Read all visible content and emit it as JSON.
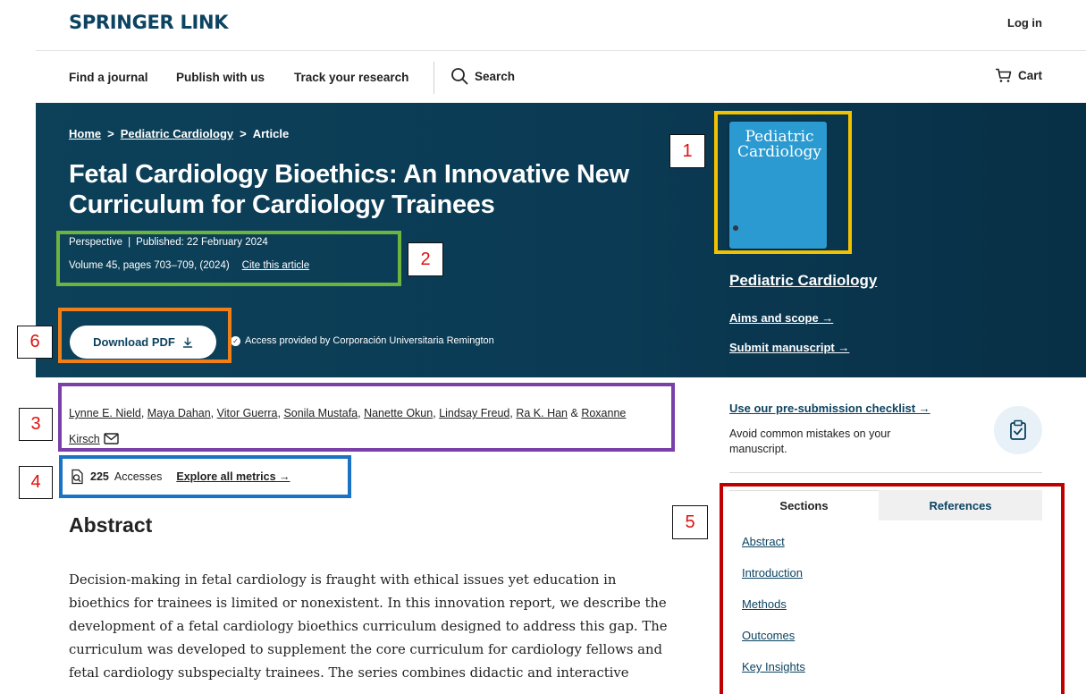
{
  "header": {
    "logo": "SPRINGER LINK",
    "login": "Log in"
  },
  "nav": {
    "find_journal": "Find a journal",
    "publish": "Publish with us",
    "track": "Track your research",
    "search": "Search",
    "cart": "Cart"
  },
  "breadcrumb": {
    "home": "Home",
    "journal": "Pediatric Cardiology",
    "article": "Article",
    "separator": ">"
  },
  "article": {
    "title": "Fetal Cardiology Bioethics: An Innovative New Curriculum for Cardiology Trainees",
    "type": "Perspective",
    "published": "Published: 22 February 2024",
    "volume": "Volume 45, pages 703–709, (2024)",
    "cite": "Cite this article",
    "download_pdf": "Download PDF",
    "access": "Access provided by Corporación Universitaria Remington"
  },
  "journal": {
    "cover_title": "Pediatric Cardiology",
    "name": "Pediatric Cardiology",
    "aims": "Aims and scope →",
    "submit": "Submit manuscript →"
  },
  "authors": {
    "list": [
      "Lynne E. Nield",
      "Maya Dahan",
      "Vitor Guerra",
      "Sonila Mustafa",
      "Nanette Okun",
      "Lindsay Freud",
      "Ra K. Han"
    ],
    "last": "Roxanne Kirsch",
    "amp": "&"
  },
  "metrics": {
    "accesses_count": "225",
    "accesses_label": "Accesses",
    "explore": "Explore all metrics →"
  },
  "abstract": {
    "heading": "Abstract",
    "text": "Decision-making in fetal cardiology is fraught with ethical issues yet education in bioethics for trainees is limited or nonexistent. In this innovation report, we describe the development of a fetal cardiology bioethics curriculum designed to address this gap. The curriculum was developed to supplement the core curriculum for cardiology fellows and fetal cardiology subspecialty trainees. The series combines didactic and interactive"
  },
  "sidebar": {
    "checklist_link": "Use our pre-submission checklist →",
    "checklist_desc": "Avoid common mistakes on your manuscript.",
    "tabs": {
      "sections": "Sections",
      "references": "References"
    },
    "sections": [
      "Abstract",
      "Introduction",
      "Methods",
      "Outcomes",
      "Key Insights"
    ]
  },
  "annotations": {
    "labels": [
      "1",
      "2",
      "3",
      "4",
      "5",
      "6"
    ],
    "colors": {
      "1": "#f2c200",
      "2": "#6db33f",
      "3": "#7a3fa8",
      "4": "#1a73c4",
      "5": "#c00000",
      "6": "#f07f1a"
    }
  },
  "colors": {
    "brand": "#0c4361",
    "hero_bg": "#0b3a54",
    "link": "#0c4361"
  },
  "icons": [
    "search-icon",
    "cart-icon",
    "download-icon",
    "check-icon",
    "mail-icon",
    "metrics-icon",
    "clipboard-icon"
  ]
}
